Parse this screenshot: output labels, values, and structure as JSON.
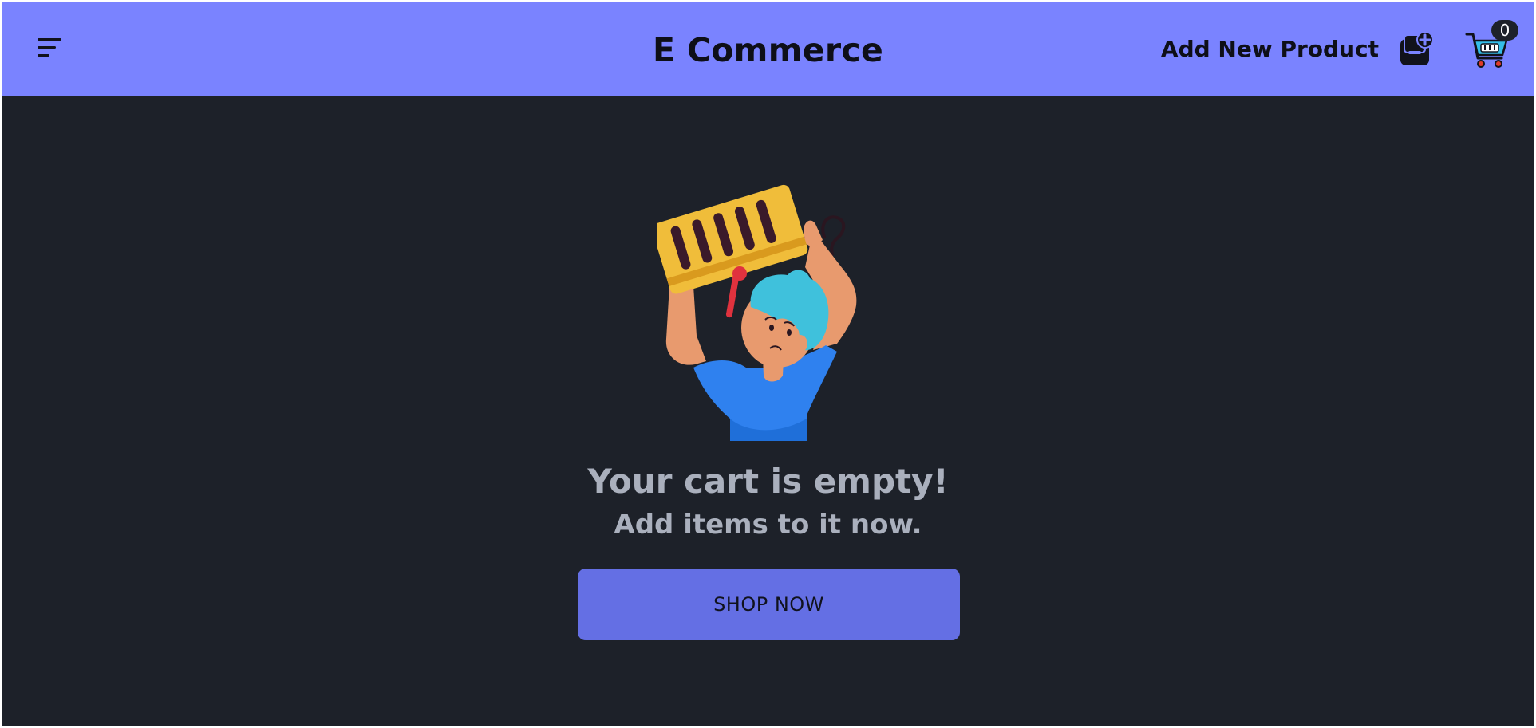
{
  "header": {
    "brand": "E Commerce",
    "add_product_label": "Add New Product",
    "cart_count": "0",
    "icons": {
      "menu": "menu-lines-icon",
      "add_product": "add-product-icon",
      "cart": "shopping-cart-icon"
    }
  },
  "empty_cart": {
    "title": "Your cart is empty!",
    "subtitle": "Add items to it now.",
    "button_label": "SHOP NOW"
  },
  "colors": {
    "navbar": "#7a83ff",
    "background": "#1d2129",
    "button": "#646fe4",
    "text_muted": "#aab0bd"
  }
}
